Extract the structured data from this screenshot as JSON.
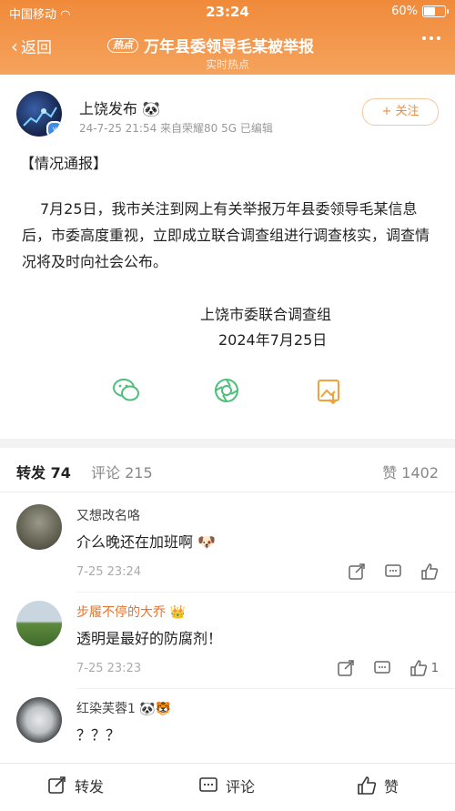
{
  "status": {
    "carrier": "中国移动",
    "time": "23:24",
    "battery": "60%",
    "battery_level": 0.6
  },
  "nav": {
    "back_label": "返回",
    "hot_badge": "热点",
    "title": "万年县委领导毛某被举报",
    "subtitle": "实时热点"
  },
  "post": {
    "author": "上饶发布",
    "meta": "24-7-25 21:54  来自荣耀80 5G  已编辑",
    "follow_label": "+ 关注",
    "header": "【情况通报】",
    "body": "7月25日，我市关注到网上有关举报万年县委领导毛某信息后，市委高度重视，立即成立联合调查组进行调查核实，调查情况将及时向社会公布。",
    "signature": "上饶市委联合调查组",
    "date": "2024年7月25日",
    "share_icons": [
      "wechat-icon",
      "moments-icon",
      "save-image-icon"
    ]
  },
  "tabs": {
    "repost": "转发 74",
    "comment": "评论 215",
    "like": "赞 1402"
  },
  "comments": [
    {
      "name": "又想改名咯",
      "text": "介么晚还在加班啊",
      "emoji": "🐶",
      "time": "7-25 23:24",
      "likes": ""
    },
    {
      "name": "步履不停的大乔",
      "text": "透明是最好的防腐剂！",
      "emoji": "",
      "time": "7-25 23:23",
      "likes": "1"
    },
    {
      "name": "红染芙蓉1",
      "text": "？？？",
      "emoji": "",
      "time": "",
      "likes": ""
    }
  ],
  "bottom": {
    "repost": "转发",
    "comment": "评论",
    "like": "赞"
  },
  "colors": {
    "accent": "#f08a3a",
    "follow_border": "#f3c89b",
    "vip_name": "#e7722a"
  }
}
